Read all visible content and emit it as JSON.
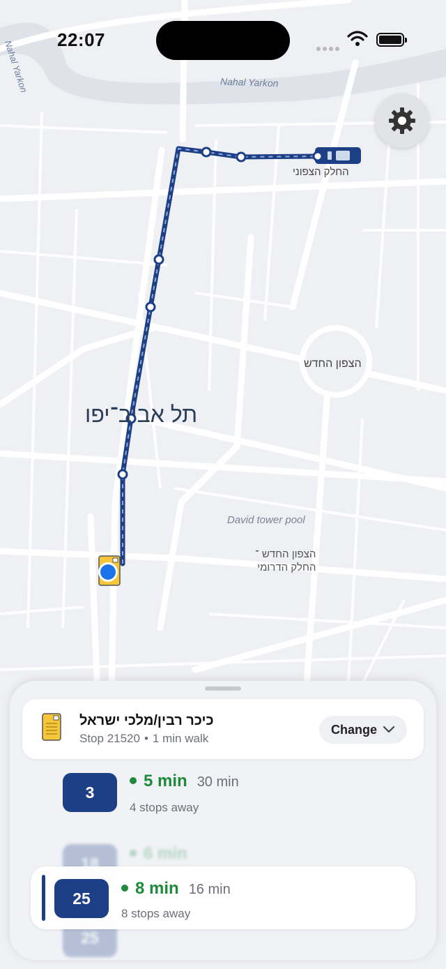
{
  "status_bar": {
    "time": "22:07"
  },
  "map": {
    "labels": {
      "city": "תל אביב־יפו",
      "circle": "הצפון החדש",
      "north_part": "החלק הצפוני",
      "river": "Nahal Yarkon",
      "river_west": "Nahal Yarkon",
      "pool": "David tower pool",
      "south_line1": "הצפון החדש ־",
      "south_line2": "החלק הדרומי"
    },
    "colors": {
      "route": "#1d3f86",
      "user_location": "#1a73e8",
      "bus_stop": "#f5c53a"
    }
  },
  "sheet": {
    "stop": {
      "name": "כיכר רבין/מלכי ישראל",
      "code": "Stop 21520",
      "walk": "1 min walk",
      "separator": "•",
      "change_label": "Change"
    },
    "routes": [
      {
        "number": "3",
        "live": "5 min",
        "scheduled": "30 min",
        "stops_away": "4 stops away"
      },
      {
        "number": "18",
        "live": "6 min",
        "scheduled": "",
        "stops_away": ""
      },
      {
        "number": "25",
        "live": "8 min",
        "scheduled": "16 min",
        "stops_away": "8 stops away"
      },
      {
        "number": "25",
        "live": "",
        "scheduled": "",
        "stops_away": ""
      }
    ],
    "colors": {
      "badge": "#1d3f86",
      "live_eta": "#1f8a3a"
    }
  }
}
